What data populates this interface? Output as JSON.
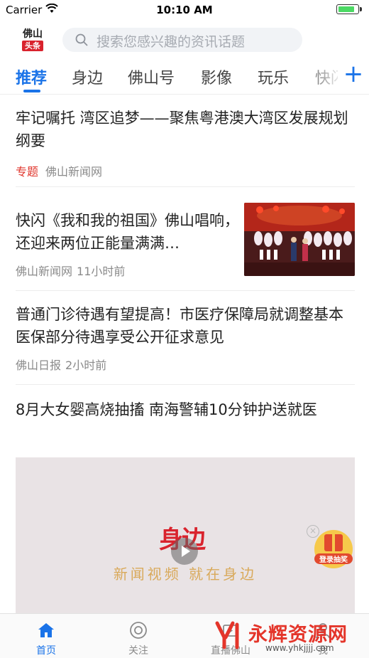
{
  "status_bar": {
    "carrier": "Carrier",
    "time": "10:10 AM"
  },
  "header": {
    "logo_line1": "佛山",
    "logo_line2": "头条",
    "search_placeholder": "搜索您感兴趣的资讯话题"
  },
  "tabs": [
    {
      "label": "推荐",
      "active": true
    },
    {
      "label": "身边"
    },
    {
      "label": "佛山号"
    },
    {
      "label": "影像"
    },
    {
      "label": "玩乐"
    },
    {
      "label": "快闪"
    }
  ],
  "add_tab_symbol": "+",
  "feed": [
    {
      "title": "牢记嘱托 湾区追梦——聚焦粤港澳大湾区发展规划纲要",
      "tag": "专题",
      "source": "佛山新闻网",
      "time": ""
    },
    {
      "title": "快闪《我和我的祖国》佛山唱响，还迎来两位正能量满满…",
      "tag": "",
      "source": "佛山新闻网",
      "time": "11小时前"
    },
    {
      "title": "普通门诊待遇有望提高！市医疗保障局就调整基本医保部分待遇享受公开征求意见",
      "tag": "",
      "source": "佛山日报",
      "time": "2小时前"
    },
    {
      "title": "8月大女婴高烧抽搐 南海警辅10分钟护送就医"
    }
  ],
  "video_card": {
    "brand": "身边",
    "slogan": "新闻视频 就在身边"
  },
  "float_button": {
    "label": "登录抽奖"
  },
  "bottom_nav": [
    {
      "label": "首页",
      "icon": "home-icon",
      "active": true
    },
    {
      "label": "关注",
      "icon": "follow-icon"
    },
    {
      "label": "直播佛山",
      "icon": "live-icon"
    },
    {
      "label": "我",
      "icon": "user-icon"
    }
  ],
  "watermark": {
    "text": "永辉资源网",
    "url": "www.yhkjjjj.com"
  },
  "colors": {
    "accent": "#1a73e8",
    "tag_red": "#e0342b",
    "brand_red": "#d9232d"
  }
}
